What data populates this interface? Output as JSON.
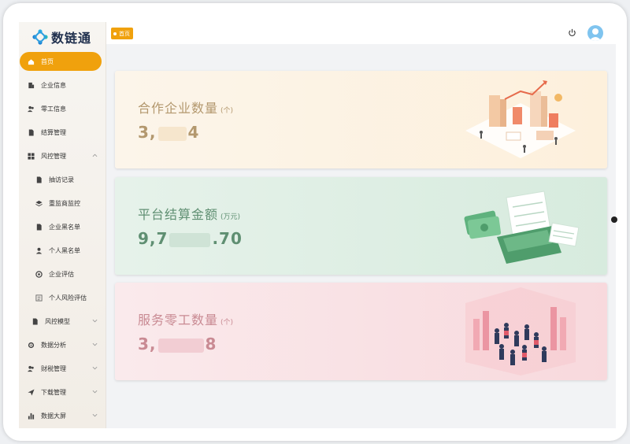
{
  "app": {
    "name": "数链通"
  },
  "sidebar": {
    "items": [
      {
        "label": "首页",
        "icon": "home-icon",
        "active": true
      },
      {
        "label": "企业信息",
        "icon": "building-icon"
      },
      {
        "label": "零工信息",
        "icon": "users-icon"
      },
      {
        "label": "结算管理",
        "icon": "document-icon"
      },
      {
        "label": "风控管理",
        "icon": "grid-icon",
        "expanded": true
      },
      {
        "label": "抽访记录",
        "icon": "file-icon",
        "sub": true
      },
      {
        "label": "重监商监控",
        "icon": "layers-icon",
        "sub": true
      },
      {
        "label": "企业黑名单",
        "icon": "file-icon",
        "sub": true
      },
      {
        "label": "个人黑名单",
        "icon": "user-icon",
        "sub": true
      },
      {
        "label": "企业评估",
        "icon": "target-icon",
        "sub": true
      },
      {
        "label": "个人风险评估",
        "icon": "list-icon",
        "sub": true
      },
      {
        "label": "风控模型",
        "icon": "file-icon",
        "sub2": true,
        "collapsible": true
      },
      {
        "label": "数据分析",
        "icon": "settings-icon",
        "collapsible": true
      },
      {
        "label": "财税管理",
        "icon": "users-icon",
        "collapsible": true
      },
      {
        "label": "下载管理",
        "icon": "send-icon",
        "collapsible": true
      },
      {
        "label": "数据大屏",
        "icon": "bar-chart-icon",
        "collapsible": true
      }
    ]
  },
  "topbar": {
    "breadcrumb": "首页",
    "power_icon": "power-icon",
    "avatar_icon": "user-avatar-icon"
  },
  "cards": [
    {
      "title": "合作企业数量",
      "unit": "(个)",
      "value_prefix": "3,",
      "value_suffix": "4",
      "illustration": "city-isometric-illustration",
      "color": "#b3986e"
    },
    {
      "title": "平台结算金额",
      "unit": "(万元)",
      "value_prefix": "9,7",
      "value_suffix": ".70",
      "illustration": "payment-terminal-illustration",
      "color": "#5f8f72"
    },
    {
      "title": "服务零工数量",
      "unit": "(个)",
      "value_prefix": "3,",
      "value_suffix": "8",
      "illustration": "crowd-illustration",
      "color": "#c98a93"
    }
  ],
  "colors": {
    "accent": "#f0a10d"
  }
}
